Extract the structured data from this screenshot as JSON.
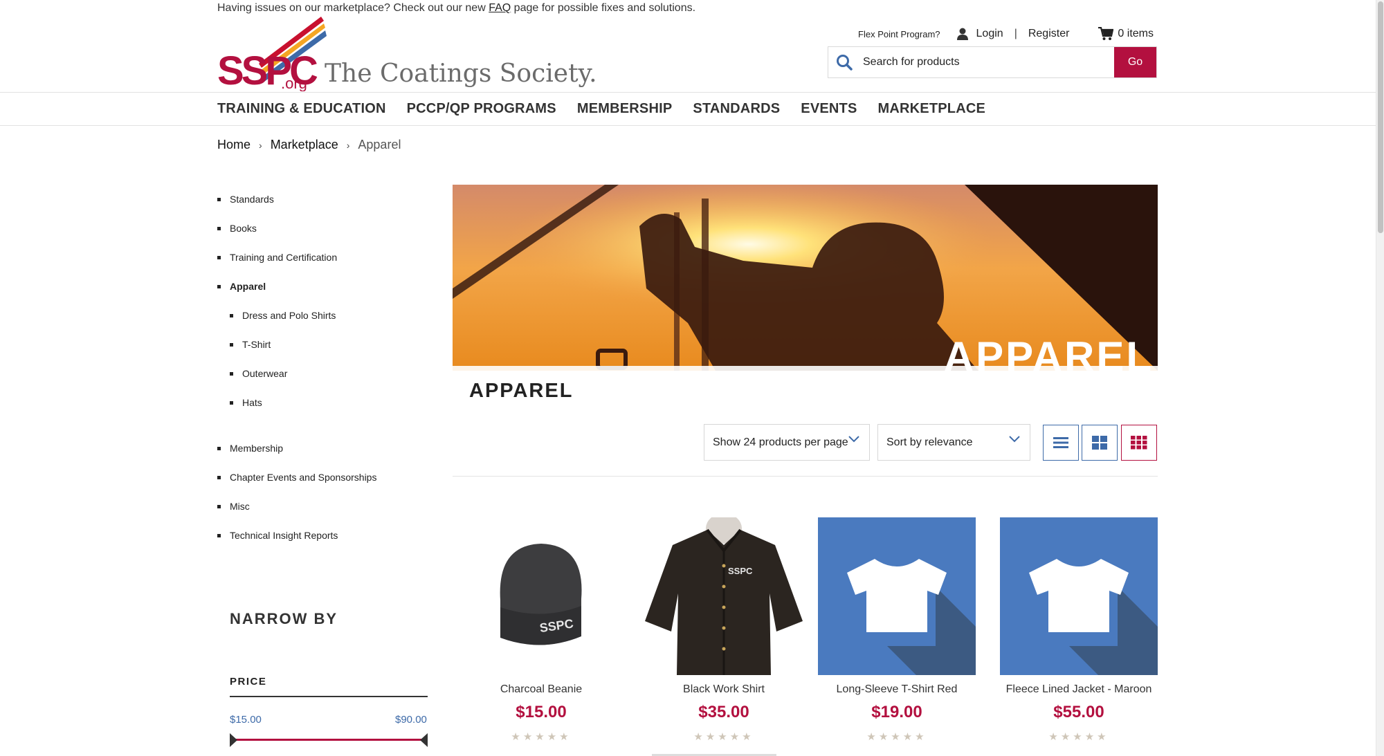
{
  "notice": {
    "before": "Having issues on our marketplace? Check out our new ",
    "link": "FAQ",
    "after": " page for possible fixes and solutions."
  },
  "logo": {
    "mark": "SSPC",
    "suffix": ".org",
    "tagline": "The Coatings Society."
  },
  "top_links": {
    "flex_point": "Flex Point Program?",
    "login": "Login",
    "separator": "|",
    "register": "Register",
    "cart": "0 items"
  },
  "search": {
    "placeholder": "Search for products",
    "go_label": "Go"
  },
  "nav": [
    "TRAINING & EDUCATION",
    "PCCP/QP PROGRAMS",
    "MEMBERSHIP",
    "STANDARDS",
    "EVENTS",
    "MARKETPLACE"
  ],
  "breadcrumb": {
    "home": "Home",
    "marketplace": "Marketplace",
    "current": "Apparel"
  },
  "sidebar": {
    "items": [
      "Standards",
      "Books",
      "Training and Certification",
      "Apparel"
    ],
    "sub_items": [
      "Dress and Polo Shirts",
      "T-Shirt",
      "Outerwear",
      "Hats"
    ],
    "more_items": [
      "Membership",
      "Chapter Events and Sponsorships",
      "Misc",
      "Technical Insight Reports"
    ]
  },
  "filters": {
    "narrow_by": "NARROW BY",
    "price_heading": "PRICE",
    "price_min": "$15.00",
    "price_max": "$90.00"
  },
  "banner": {
    "word": "APPAREL"
  },
  "page_title": "APPAREL",
  "toolbar": {
    "per_page": "Show 24 products per page",
    "sort": "Sort by relevance"
  },
  "products": [
    {
      "name": "Charcoal Beanie",
      "price": "$15.00",
      "rating": "★★★★★"
    },
    {
      "name": "Black Work Shirt",
      "price": "$35.00",
      "rating": "★★★★★"
    },
    {
      "name": "Long-Sleeve T-Shirt Red",
      "price": "$19.00",
      "rating": "★★★★★"
    },
    {
      "name": "Fleece Lined Jacket - Maroon",
      "price": "$55.00",
      "rating": "★★★★★"
    }
  ],
  "colors": {
    "brand_red": "#b3103f",
    "link_blue": "#3d6aa8",
    "placeholder_blue": "#4a7abf"
  }
}
